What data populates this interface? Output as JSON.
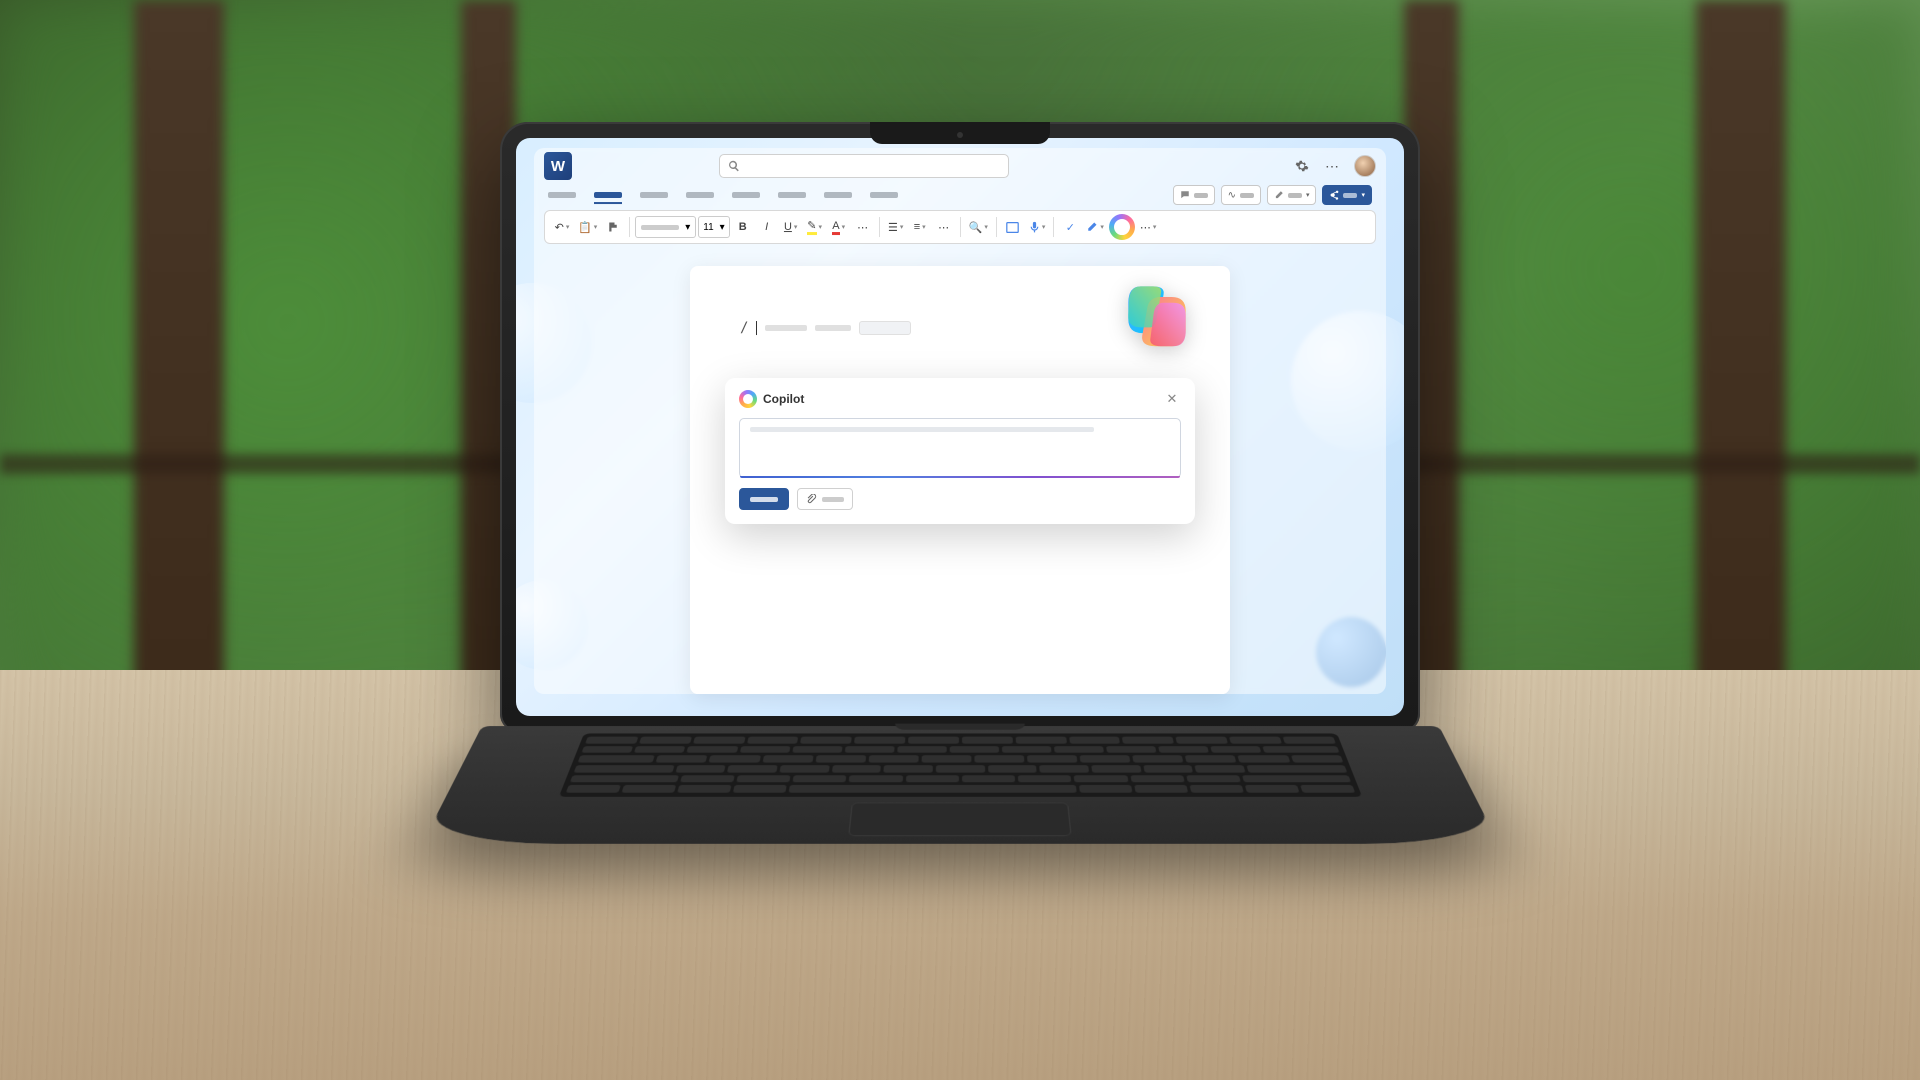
{
  "app": {
    "name": "W"
  },
  "search": {
    "placeholder": ""
  },
  "tabs": {
    "count": 8,
    "active_index": 1
  },
  "toolbar": {
    "font_size": "11",
    "bold": "B",
    "italic": "I",
    "underline": "U"
  },
  "ribbon_actions": {
    "share_icon": "share"
  },
  "document": {
    "slash": "/"
  },
  "copilot": {
    "title": "Copilot",
    "input_placeholder": ""
  }
}
